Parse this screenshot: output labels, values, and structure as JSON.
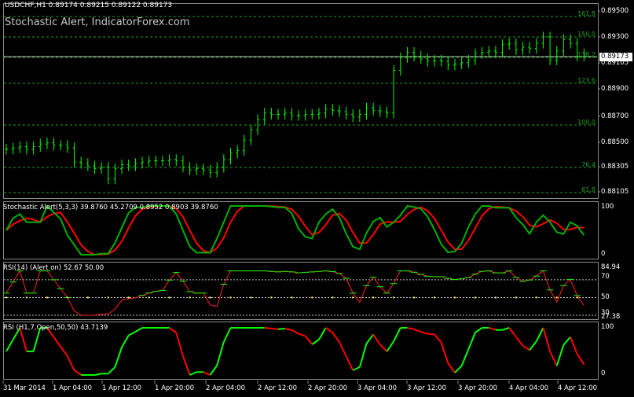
{
  "chart_title": "USDCHF,H1  0.89174 0.89215 0.89122 0.89173",
  "watermark": "Stochastic Alert, IndicatorForex.com",
  "current_price": "0.89173",
  "price_axis": [
    "0.89500",
    "0.89300",
    "0.89105",
    "0.88900",
    "0.88700",
    "0.88500",
    "0.88305",
    "0.88105"
  ],
  "fib_levels": [
    "161.8",
    "150.0",
    "138.2",
    "123.6",
    "100.0",
    "76.4",
    "61.8"
  ],
  "stoch": {
    "title": "Stochastic Alert(5,3,3) 39.8760 45.2709 0.8952 0.8903 39.8760",
    "axis_top": "100",
    "axis_bottom": "0"
  },
  "rsi": {
    "title": "RSI(14) (Alert on) 52.67 50.00",
    "axis_top": "84.94",
    "axis_70": "70",
    "axis_50": "50",
    "axis_30": "30",
    "axis_bottom": "27.38"
  },
  "rsi2": {
    "title": "RSI (H1,7,Open,50,50) 43.7139",
    "axis_top": "100",
    "axis_bottom": "0"
  },
  "time_axis": [
    "31 Mar 2014",
    "1 Apr 04:00",
    "1 Apr 12:00",
    "1 Apr 20:00",
    "2 Apr 04:00",
    "2 Apr 12:00",
    "2 Apr 20:00",
    "3 Apr 04:00",
    "3 Apr 12:00",
    "3 Apr 20:00",
    "4 Apr 04:00",
    "4 Apr 12:00"
  ],
  "colors": {
    "bars": "#00ff00",
    "fib": "#1fa01f",
    "stoch_main": "#00b000",
    "stoch_signal": "#ff0000",
    "level": "#c0c0c0",
    "dots": "#ffd84a"
  },
  "chart_data": {
    "type": "line",
    "symbol": "USDCHF",
    "timeframe": "H1",
    "close": [
      0.8843,
      0.8844,
      0.8845,
      0.8843,
      0.8845,
      0.8847,
      0.8848,
      0.8846,
      0.8846,
      0.8844,
      0.8833,
      0.8832,
      0.883,
      0.8828,
      0.8829,
      0.882,
      0.8828,
      0.8831,
      0.883,
      0.8832,
      0.8833,
      0.8834,
      0.8834,
      0.8834,
      0.8835,
      0.8834,
      0.8829,
      0.8827,
      0.8828,
      0.8827,
      0.8825,
      0.8829,
      0.8835,
      0.884,
      0.8842,
      0.885,
      0.8858,
      0.8866,
      0.8871,
      0.887,
      0.887,
      0.8871,
      0.8869,
      0.8869,
      0.887,
      0.887,
      0.8871,
      0.8874,
      0.8873,
      0.8872,
      0.887,
      0.8868,
      0.887,
      0.8875,
      0.8873,
      0.8872,
      0.8871,
      0.8904,
      0.8914,
      0.8918,
      0.8915,
      0.8913,
      0.8911,
      0.8912,
      0.8911,
      0.8908,
      0.8909,
      0.891,
      0.8912,
      0.8917,
      0.8918,
      0.8919,
      0.8918,
      0.8924,
      0.8925,
      0.892,
      0.8922,
      0.8921,
      0.8925,
      0.893,
      0.8912,
      0.8919,
      0.8928,
      0.8925,
      0.8915,
      0.8917
    ]
  }
}
